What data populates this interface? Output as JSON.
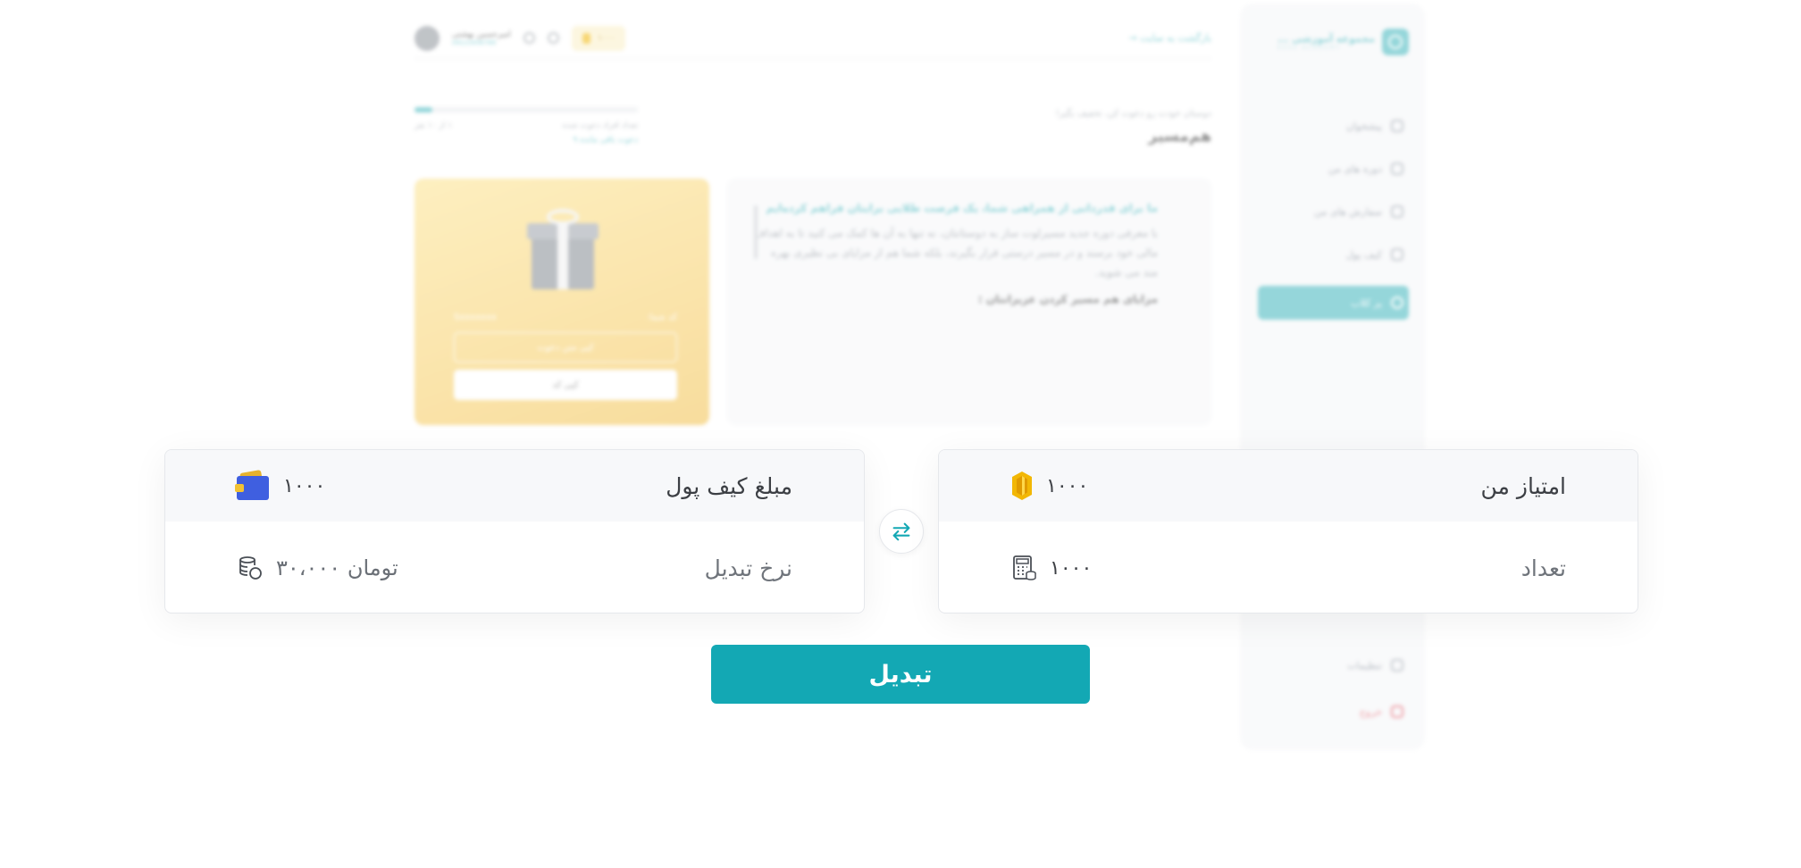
{
  "background": {
    "brand": {
      "name": "مجموعه آموزشی ...",
      "sub": "KOSE ACADEMY"
    },
    "sidebar": {
      "items": [
        {
          "label": "پیشخوان",
          "icon": "home-icon"
        },
        {
          "label": "دوره های من",
          "icon": "courses-icon"
        },
        {
          "label": "سفارش های من",
          "icon": "orders-icon"
        },
        {
          "label": "کیف پول",
          "icon": "wallet-icon"
        },
        {
          "label": "پز کلاب",
          "icon": "club-icon",
          "active": true
        }
      ],
      "bottom": [
        {
          "label": "تنظیمات",
          "icon": "settings-icon"
        },
        {
          "label": "خروج",
          "icon": "logout-icon"
        }
      ]
    },
    "header": {
      "back_link": "بازگشت به سایت",
      "user_name": "امیرحسین بهشتی",
      "user_sub": "09123456789",
      "coin_value": "۱۰۰۰"
    },
    "page": {
      "subtitle": "دوستان خودت رو دعوت کن، تخفیف بگیر!",
      "title": "هم‌مسیر",
      "progress_label": "تعداد افراد دعوت شده",
      "progress_count": "۱ از ۱۰ نفر",
      "progress_note": "۹ دعوت باقی مانده",
      "progress_fraction": 0.08
    },
    "info_card": {
      "heading": "ما برای قدردانی از همراهی شما، یک فرصت طلایی برایتان فراهم کرده‌ایم",
      "body": "با معرفی دوره جدید مسیرلوت ساز به دوستانتان، نه تنها به آن ها کمک می کنید تا به اهداف مالی خود برسند و در مسیر درستی قرار بگیرند، بلکه شما هم از مزایای بی نظیری بهره مند می شوید.",
      "subheading": "مزایای هم مسیر کردن عزیزانتان :"
    },
    "gift_card": {
      "code_label": "کد شما:",
      "code_value": "Sxxxxxxx",
      "copy_link": "کپی متن دعوت",
      "copy_code": "کپی کد"
    }
  },
  "conversion": {
    "wallet": {
      "title": "مبلغ کیف پول",
      "amount": "۱۰۰۰",
      "rate_label": "نرخ تبدیل",
      "rate_value": "۳۰،۰۰۰ تومان"
    },
    "points": {
      "title": "امتیاز من",
      "amount": "۱۰۰۰",
      "count_label": "تعداد",
      "count_value": "۱۰۰۰"
    },
    "convert_label": "تبدیل"
  },
  "colors": {
    "accent": "#13a8b4",
    "wallet_blue": "#3f5fe0",
    "coin_gold": "#f2b705"
  }
}
